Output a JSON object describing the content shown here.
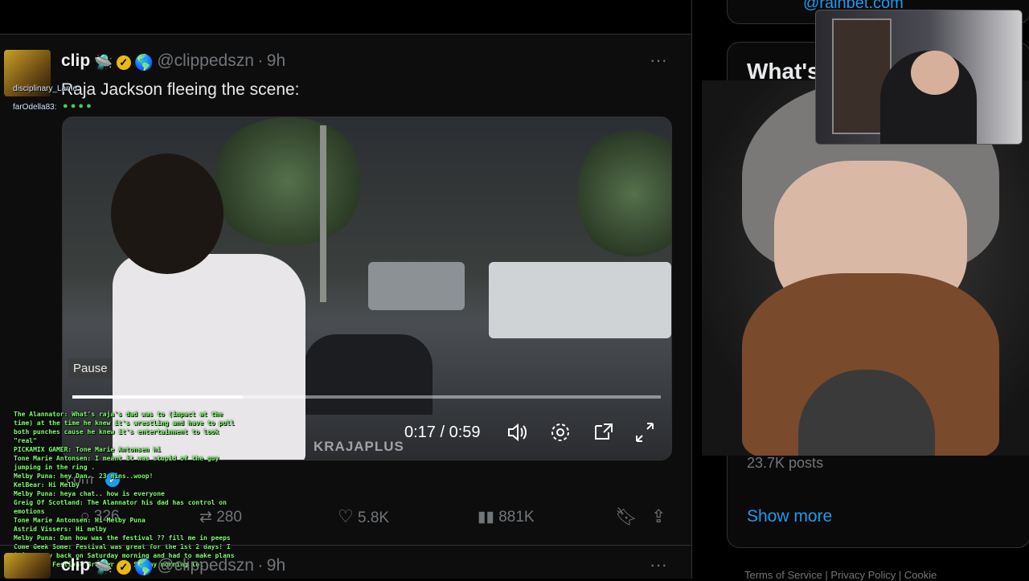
{
  "top": {
    "partial_link": "@rainbet.com"
  },
  "tweet": {
    "author": "clip",
    "handle": "@clippedszn",
    "dot": "·",
    "time": "9h",
    "more": "···",
    "text": "Raja Jackson fleeing the scene:",
    "video": {
      "pause_tooltip": "Pause",
      "time_display": "0:17 / 0:59",
      "progress": 0.29,
      "watermark": "KRAJAPLUS"
    },
    "stats": {
      "replies": "326",
      "reposts": "280",
      "likes": "5.8K",
      "views": "881K"
    },
    "partial_link": "com"
  },
  "next_tweet": {
    "author": "clip",
    "handle": "@clippedszn",
    "dot": "·",
    "time": "9h",
    "more": "···"
  },
  "overlay_chat_top": [
    {
      "user": "disciplinary_Lame:",
      "msg": ""
    },
    {
      "user": "farOdella83:",
      "msg": ""
    }
  ],
  "overlay_chat": [
    "The Alannator: What's raja's dad was to (impact at the time) at the time he knew it's wrestling and have to pull both punches cause he knew it's entertainment to look \"real\"",
    "PICKAMIX GAMER: Tone Marie Antonsen hi",
    "Tone Marie Antonsen: I meant it was stupid of the guy jumping in the ring .",
    "Melby Puna: hey Dan.. 23 mins..woop!",
    "KelBear: Hi Melby",
    "Melby Puna: heya chat.. how is everyone",
    "Greig Of Scotland: The Alannator his dad has control on emotions",
    "Tone Marie Antonsen: Hi Melby Puna",
    "Astrid Vissers: Hi melby",
    "Melby Puna: Dan how was the festival ?? fill me in peeps",
    "Come Geek Some: Festival was great for the 1st 2 days! I injured my back on Saturday morning and had to make plans to get my Festival Brother ... Sunday morning lol"
  ],
  "right": {
    "trending_title": "What's",
    "posts_count": "23.7K posts",
    "show_more": "Show more",
    "footer": "Terms of Service  |  Privacy Policy  |  Cookie"
  }
}
